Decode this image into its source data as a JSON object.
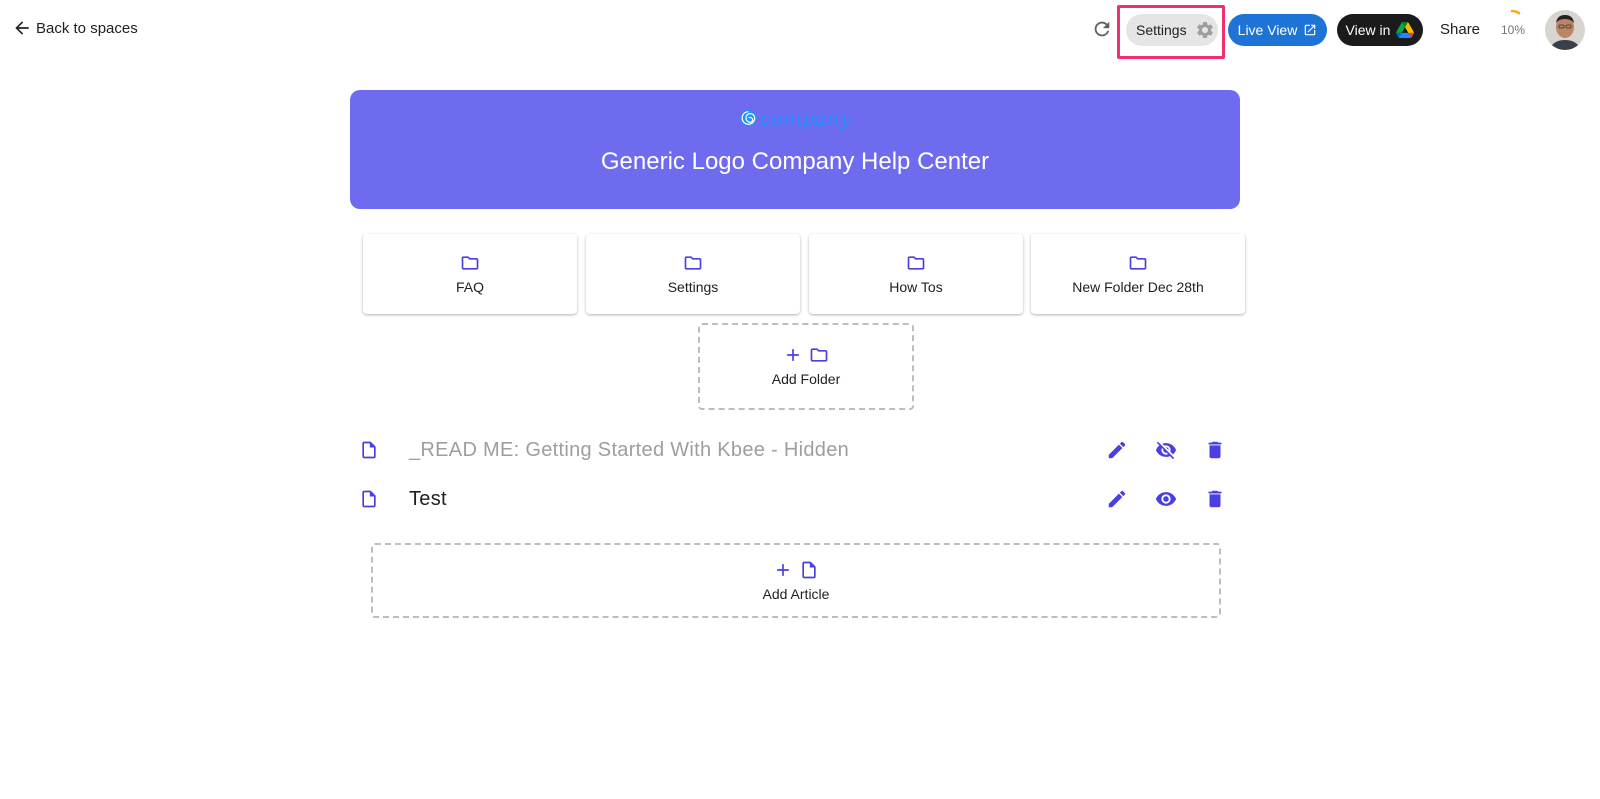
{
  "nav": {
    "back_label": "Back to spaces"
  },
  "toolbar": {
    "settings_label": "Settings",
    "live_view_label": "Live View",
    "view_in_label": "View in",
    "share_label": "Share",
    "progress_text": "10%",
    "progress_value": 0.1
  },
  "banner": {
    "logo_text": "company",
    "title": "Generic Logo Company Help Center",
    "color": "#6f6bee"
  },
  "folders": [
    {
      "label": "FAQ"
    },
    {
      "label": "Settings"
    },
    {
      "label": "How Tos"
    },
    {
      "label": "New Folder Dec 28th"
    }
  ],
  "add_folder_label": "Add Folder",
  "articles": [
    {
      "title": "_READ ME: Getting Started With Kbee - Hidden",
      "hidden": true
    },
    {
      "title": "Test",
      "hidden": false
    }
  ],
  "add_article_label": "Add Article",
  "colors": {
    "accent": "#4a3fe0",
    "highlight": "#f0306e",
    "live_view": "#1e74d6",
    "drive_button": "#1b1b1b"
  }
}
